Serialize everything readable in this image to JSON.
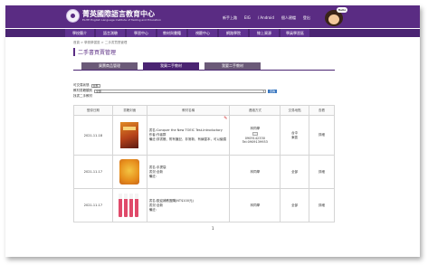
{
  "header": {
    "title": "菁英國際語言教育中心",
    "subtitle": "ELITE English Language Institute of Testing and Education",
    "links": [
      "新手上路",
      "EIG",
      "/ Android",
      "個人建檔",
      "登出"
    ],
    "mascot_text": "Hello"
  },
  "nav": [
    "學校簡介",
    "語言測驗",
    "學習中心",
    "教材與書籍",
    "視聽中心",
    "網路學院",
    "線上資源",
    "學員學習區"
  ],
  "breadcrumb": "首頁 > 學員學習區 > 二手書買賣管理",
  "page_title": "二手書買賣管理",
  "tabs": [
    {
      "label": "買賣商品管理",
      "active": false
    },
    {
      "label": "我買二手教材",
      "active": true
    },
    {
      "label": "我要二手教材",
      "active": false
    }
  ],
  "filters": {
    "type_label": "可交易狀態",
    "type_value": "全部",
    "class_label": "教材書籍類別",
    "class_value": "全部",
    "search_button": "查詢",
    "count": "找書二手教材"
  },
  "table": {
    "headers": [
      "登錄日期",
      "書籍封面",
      "教材名稱",
      "連絡方式",
      "交易地點",
      "查看"
    ],
    "rows": [
      {
        "date": "2021-11-18",
        "title": "書名:Conquer the New TOEIC Test-Introductory",
        "author": "作者:作者群",
        "note": "備註:詳書籤、附有筆記、非常新、有練習本，可以議價",
        "contact_name": "林同學",
        "phone1": "0909142330",
        "phone2": "Tel:0909139933",
        "place": "台中",
        "place2": "東區",
        "view": "詳細"
      },
      {
        "date": "2021-11-17",
        "title": "書名:手提袋",
        "author": "書況:全新",
        "note": "備註:",
        "contact_name": "林同學",
        "phone1": "",
        "phone2": "",
        "place": "全部",
        "place2": "",
        "view": "詳細"
      },
      {
        "date": "2021-11-17",
        "title": "書名:歡迎補教團購(NT$100元)",
        "author": "書況:全新",
        "note": "備註:",
        "contact_name": "林同學",
        "phone1": "",
        "phone2": "",
        "place": "全部",
        "place2": "",
        "view": "詳細"
      }
    ]
  },
  "pager": "1",
  "colors": {
    "brand": "#5a2c83",
    "nav": "#4a2472",
    "button": "#3a77c0"
  }
}
